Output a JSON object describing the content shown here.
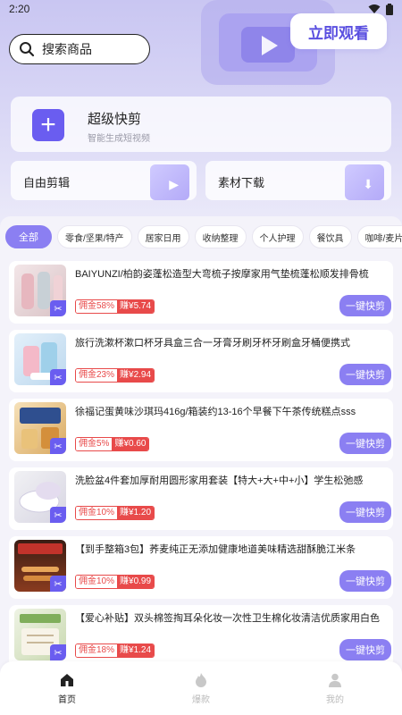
{
  "status": {
    "time": "2:20"
  },
  "search": {
    "placeholder": "搜索商品"
  },
  "watch_button": "立即观看",
  "feature": {
    "title": "超级快剪",
    "subtitle": "智能生成短视频"
  },
  "quick": {
    "edit": "自由剪辑",
    "download": "素材下载"
  },
  "categories": [
    "全部",
    "零食/坚果/特产",
    "居家日用",
    "收纳整理",
    "个人护理",
    "餐饮具",
    "咖啡/麦片/冲"
  ],
  "products": [
    {
      "name": "BAIYUNZI/柏韵姿蓬松造型大弯梳子按摩家用气垫梳蓬松顺发排骨梳",
      "commission": "佣金58%",
      "earn": "赚¥5.74",
      "action": "一键快剪"
    },
    {
      "name": "旅行洗漱杯漱口杯牙具盒三合一牙膏牙刷牙杯牙刷盒牙桶便携式",
      "commission": "佣金23%",
      "earn": "赚¥2.94",
      "action": "一键快剪"
    },
    {
      "name": "徐福记蛋黄味沙琪玛416g/箱装约13-16个早餐下午茶传统糕点sss",
      "commission": "佣金5%",
      "earn": "赚¥0.60",
      "action": "一键快剪"
    },
    {
      "name": "洗脸盆4件套加厚耐用圆形家用套装【特大+大+中+小】学生松弛感",
      "commission": "佣金10%",
      "earn": "赚¥1.20",
      "action": "一键快剪"
    },
    {
      "name": "【到手整箱3包】荞麦纯正无添加健康地道美味精选甜酥脆江米条",
      "commission": "佣金10%",
      "earn": "赚¥0.99",
      "action": "一键快剪"
    },
    {
      "name": "【爱心补贴】双头棉签掏耳朵化妆一次性卫生棉化妆清洁优质家用白色",
      "commission": "佣金18%",
      "earn": "赚¥1.24",
      "action": "一键快剪"
    }
  ],
  "tabs": [
    {
      "label": "首页",
      "icon": "home-icon"
    },
    {
      "label": "爆款",
      "icon": "flame-icon"
    },
    {
      "label": "我的",
      "icon": "user-icon"
    }
  ],
  "colors": {
    "accent": "#8b7ff2",
    "brand": "#6a5df0",
    "price_red": "#e84a4a"
  }
}
